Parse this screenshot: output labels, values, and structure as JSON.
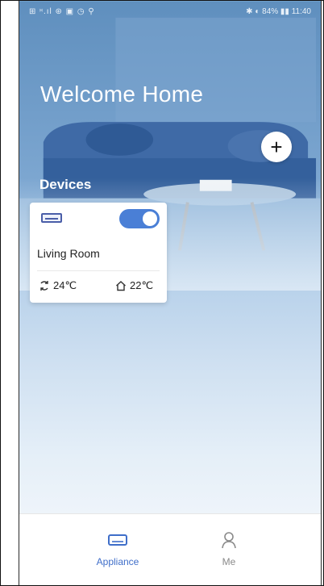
{
  "status_bar": {
    "left_text": "⊞ ᵸ.ıl ⊛ ▣ ◷ ⚲",
    "right_text": "✱ ◐ 84% ▮▮ 11:40"
  },
  "header": {
    "title": "Welcome Home",
    "add_icon": "plus-icon"
  },
  "devices": {
    "section_label": "Devices",
    "items": [
      {
        "name": "Living Room",
        "power_on": true,
        "set_temp": "24℃",
        "indoor_temp": "22℃"
      }
    ]
  },
  "tabbar": {
    "tabs": [
      {
        "label": "Appliance",
        "active": true,
        "icon": "air-conditioner-icon"
      },
      {
        "label": "Me",
        "active": false,
        "icon": "person-icon"
      }
    ]
  },
  "colors": {
    "accent": "#3f6ec9",
    "toggle_on": "#4a7fd6",
    "inactive": "#8a8a8a"
  }
}
